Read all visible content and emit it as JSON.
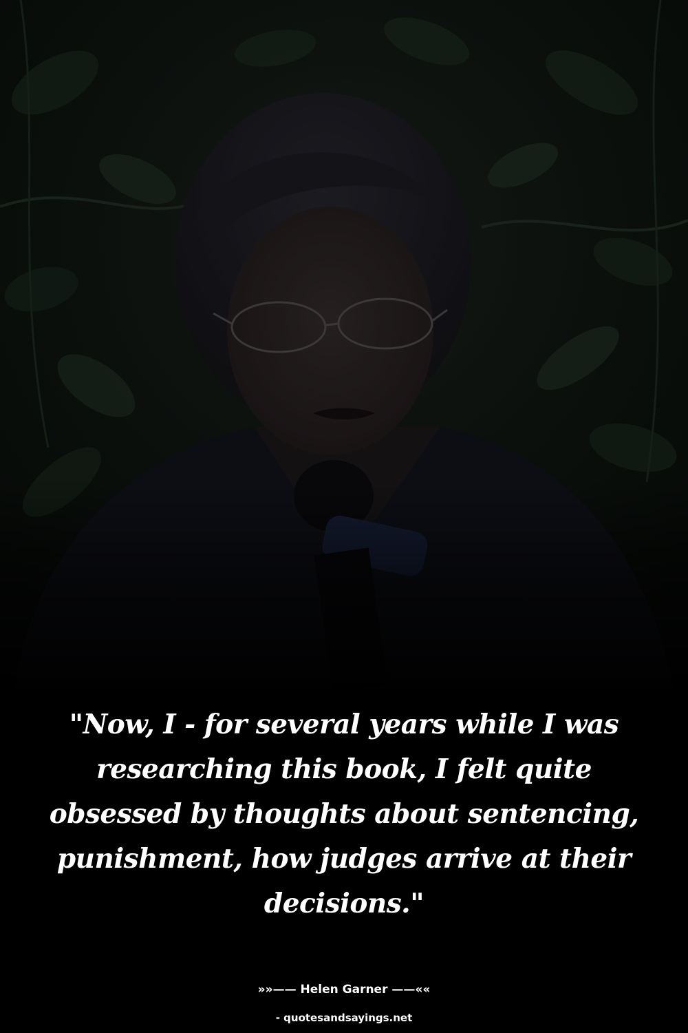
{
  "quote": {
    "text": "\"Now, I - for several years while I was researching this book, I felt quite obsessed by thoughts about sentencing, punishment, how judges arrive at their decisions.\""
  },
  "attribution": {
    "author_line": "»»—— Helen Garner ——««"
  },
  "footer": {
    "source": "- quotesandsayings.net"
  },
  "colors": {
    "background": "#000000",
    "text": "#ffffff",
    "foliage": "#17221a"
  }
}
